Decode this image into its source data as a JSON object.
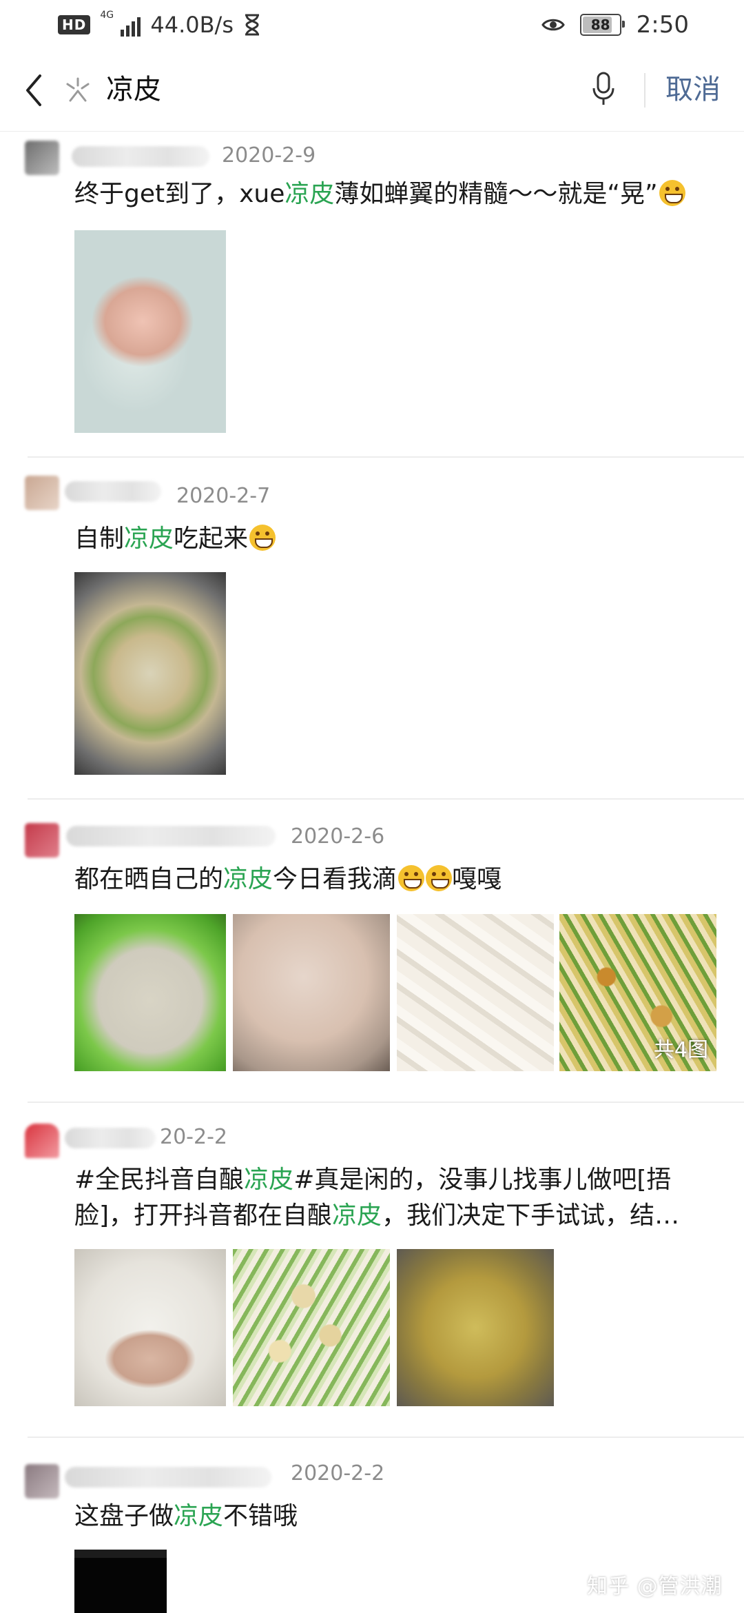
{
  "status_bar": {
    "hd": "HD",
    "network": "4G",
    "speed": "44.0B/s",
    "battery": "88",
    "battery_level": 0.88,
    "time": "2:50"
  },
  "search": {
    "query": "凉皮",
    "cancel_label": "取消"
  },
  "highlight_color": "#2aa452",
  "posts": [
    {
      "date": "2020-2-9",
      "text_before": "终于get到了，xue",
      "keyword": "凉皮",
      "text_after": "薄如蝉翼的精髓～～就是“晃”",
      "images": 1
    },
    {
      "date": "2020-2-7",
      "text_before": "自制",
      "keyword": "凉皮",
      "text_after": "吃起来",
      "images": 1
    },
    {
      "date": "2020-2-6",
      "text_before": "都在晒自己的",
      "keyword": "凉皮",
      "text_after": "今日看我滴",
      "text_tail": "嘎嘎",
      "image_count_badge": "共4图"
    },
    {
      "date_partial": "20-2-2",
      "line1_before": "#全民抖音自酿",
      "keyword": "凉皮",
      "line1_after": "#真是闲的，没事儿找事儿做吧[捂",
      "line2_before": "脸]，打开抖音都在自酿",
      "keyword2": "凉皮",
      "line2_after": "，我们决定下手试试，结…"
    },
    {
      "date": "2020-2-2",
      "text_before": "这盘子做",
      "keyword": "凉皮",
      "text_after": "不错哦"
    }
  ],
  "watermark": "知乎 @管洪潮"
}
